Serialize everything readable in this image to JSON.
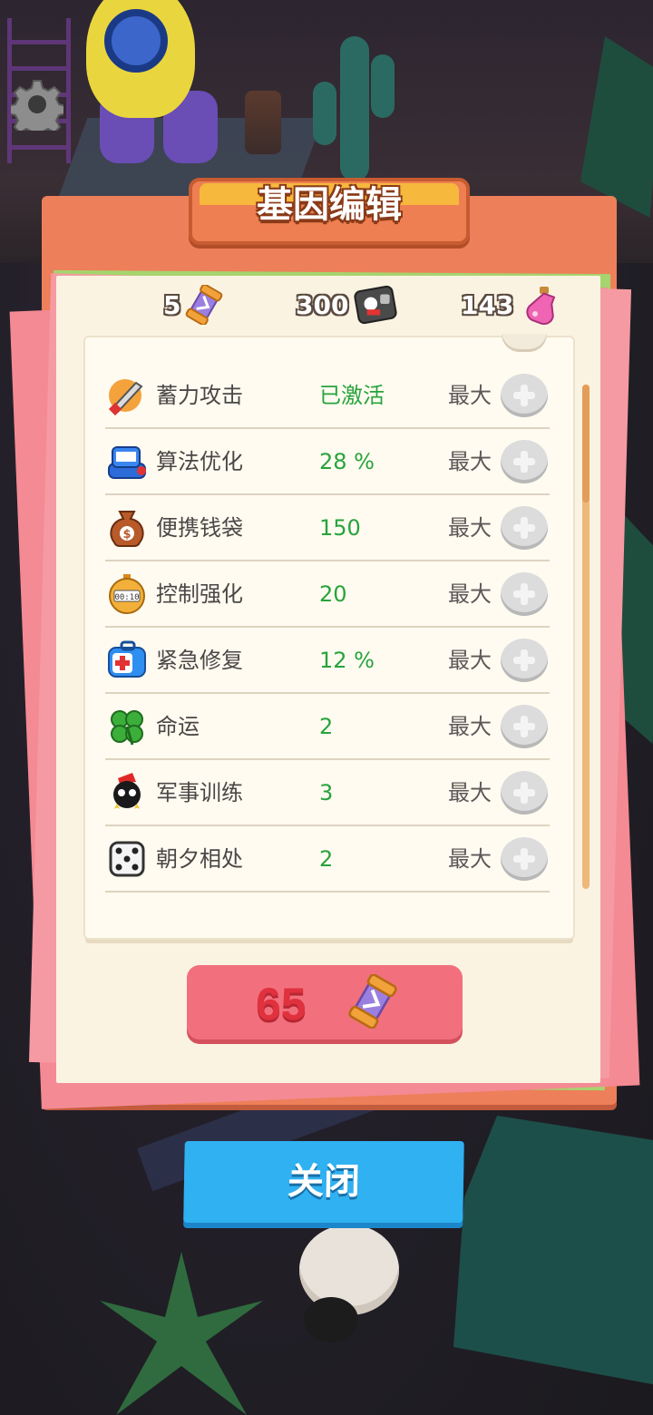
{
  "title": "基因编辑",
  "resources": [
    {
      "value": "5",
      "icon": "dna-capsule-icon"
    },
    {
      "value": "300",
      "icon": "mech-parts-icon"
    },
    {
      "value": "143",
      "icon": "potion-flask-icon"
    }
  ],
  "genes": [
    {
      "name": "蓄力攻击",
      "value": "已激活",
      "level": "最大",
      "icon": "charged-sword-icon"
    },
    {
      "name": "算法优化",
      "value": "28 %",
      "level": "最大",
      "icon": "timer-bomb-icon"
    },
    {
      "name": "便携钱袋",
      "value": "150",
      "level": "最大",
      "icon": "money-bag-icon"
    },
    {
      "name": "控制强化",
      "value": "20",
      "level": "最大",
      "icon": "stopwatch-icon"
    },
    {
      "name": "紧急修复",
      "value": "12 %",
      "level": "最大",
      "icon": "first-aid-kit-icon"
    },
    {
      "name": "命运",
      "value": "2",
      "level": "最大",
      "icon": "four-leaf-clover-icon"
    },
    {
      "name": "军事训练",
      "value": "3",
      "level": "最大",
      "icon": "soldier-bomb-icon"
    },
    {
      "name": "朝夕相处",
      "value": "2",
      "level": "最大",
      "icon": "dice-icon"
    }
  ],
  "cost": {
    "value": "65",
    "icon": "dna-capsule-icon"
  },
  "close_label": "关闭",
  "colors": {
    "panel": "#ed7f5a",
    "accent_green": "#28a33c",
    "close_button": "#2fb1f2",
    "cost_button": "#f2707d"
  }
}
